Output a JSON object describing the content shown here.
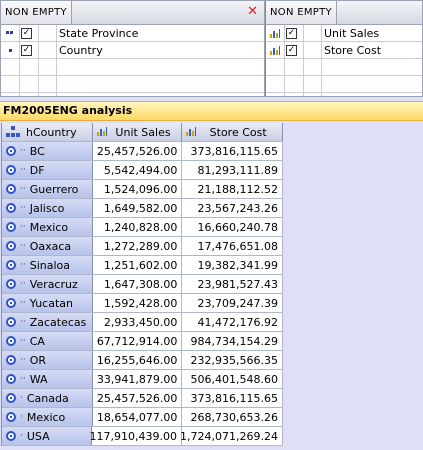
{
  "rows_panel": {
    "header": "NON EMPTY",
    "close_glyph": "✕",
    "items": [
      {
        "label": "State Province",
        "icon": "level-2-dots-icon",
        "checked": true
      },
      {
        "label": "Country",
        "icon": "level-1-dot-icon",
        "checked": true
      }
    ]
  },
  "columns_panel": {
    "header": "NON EMPTY",
    "items": [
      {
        "label": "Unit Sales",
        "icon": "measure-chart-icon",
        "checked": true
      },
      {
        "label": "Store Cost",
        "icon": "measure-chart-icon",
        "checked": true
      }
    ]
  },
  "analysis": {
    "title": "FM2005ENG analysis"
  },
  "grid": {
    "headers": {
      "dimension": "hCountry",
      "unit_sales": "Unit Sales",
      "store_cost": "Store Cost"
    },
    "rows": [
      {
        "level": "··",
        "name": "BC",
        "unit_sales": "25,457,526.00",
        "store_cost": "373,816,115.65"
      },
      {
        "level": "··",
        "name": "DF",
        "unit_sales": "5,542,494.00",
        "store_cost": "81,293,111.89"
      },
      {
        "level": "··",
        "name": "Guerrero",
        "unit_sales": "1,524,096.00",
        "store_cost": "21,188,112.52"
      },
      {
        "level": "··",
        "name": "Jalisco",
        "unit_sales": "1,649,582.00",
        "store_cost": "23,567,243.26"
      },
      {
        "level": "··",
        "name": "Mexico",
        "unit_sales": "1,240,828.00",
        "store_cost": "16,660,240.78"
      },
      {
        "level": "··",
        "name": "Oaxaca",
        "unit_sales": "1,272,289.00",
        "store_cost": "17,476,651.08"
      },
      {
        "level": "··",
        "name": "Sinaloa",
        "unit_sales": "1,251,602.00",
        "store_cost": "19,382,341.99"
      },
      {
        "level": "··",
        "name": "Veracruz",
        "unit_sales": "1,647,308.00",
        "store_cost": "23,981,527.43"
      },
      {
        "level": "··",
        "name": "Yucatan",
        "unit_sales": "1,592,428.00",
        "store_cost": "23,709,247.39"
      },
      {
        "level": "··",
        "name": "Zacatecas",
        "unit_sales": "2,933,450.00",
        "store_cost": "41,472,176.92"
      },
      {
        "level": "··",
        "name": "CA",
        "unit_sales": "67,712,914.00",
        "store_cost": "984,734,154.29"
      },
      {
        "level": "··",
        "name": "OR",
        "unit_sales": "16,255,646.00",
        "store_cost": "232,935,566.35"
      },
      {
        "level": "··",
        "name": "WA",
        "unit_sales": "33,941,879.00",
        "store_cost": "506,401,548.60"
      },
      {
        "level": "·",
        "name": "Canada",
        "unit_sales": "25,457,526.00",
        "store_cost": "373,816,115.65"
      },
      {
        "level": "·",
        "name": "Mexico",
        "unit_sales": "18,654,077.00",
        "store_cost": "268,730,653.26"
      },
      {
        "level": "·",
        "name": "USA",
        "unit_sales": "117,910,439.00",
        "store_cost": "1,724,071,269.24"
      }
    ]
  },
  "colors": {
    "title_bar": "#ffd866",
    "row_header": "#c4cdee",
    "background": "#dfe0f8",
    "close": "#e02020"
  }
}
